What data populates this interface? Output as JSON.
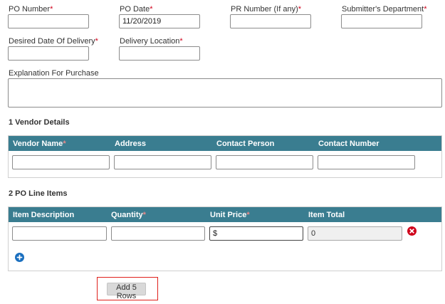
{
  "form": {
    "po_number": {
      "label": "PO Number",
      "value": ""
    },
    "po_date": {
      "label": "PO Date",
      "value": "11/20/2019"
    },
    "pr_number": {
      "label": "PR Number (If any)",
      "value": ""
    },
    "submitters_department": {
      "label": "Submitter's Department",
      "value": ""
    },
    "desired_date_of_delivery": {
      "label": "Desired Date Of Delivery",
      "value": ""
    },
    "delivery_location": {
      "label": "Delivery Location",
      "value": ""
    },
    "explanation_for_purchase": {
      "label": "Explanation For Purchase",
      "value": ""
    },
    "required_marker": "*"
  },
  "vendor_details": {
    "title": "1 Vendor Details",
    "columns": [
      {
        "label": "Vendor Name",
        "required": true
      },
      {
        "label": "Address",
        "required": false
      },
      {
        "label": "Contact Person",
        "required": false
      },
      {
        "label": "Contact Number",
        "required": false
      }
    ],
    "row": [
      "",
      "",
      "",
      ""
    ]
  },
  "po_line_items": {
    "title": "2 PO Line Items",
    "columns": [
      {
        "label": "Item Description",
        "required": false
      },
      {
        "label": "Quantity",
        "required": true
      },
      {
        "label": "Unit Price",
        "required": true
      },
      {
        "label": "Item Total",
        "required": false
      }
    ],
    "row": [
      "",
      "",
      "$",
      "0"
    ]
  },
  "buttons": {
    "add_5_rows": "Add 5 Rows"
  },
  "icons": {
    "remove_row": "close-circle-icon",
    "add_row": "plus-circle-icon"
  },
  "colors": {
    "grid_header": "#3a7d90",
    "required": "#d0021b",
    "remove": "#d0021b",
    "add": "#1a6fbf",
    "highlight": "#e0201b"
  }
}
